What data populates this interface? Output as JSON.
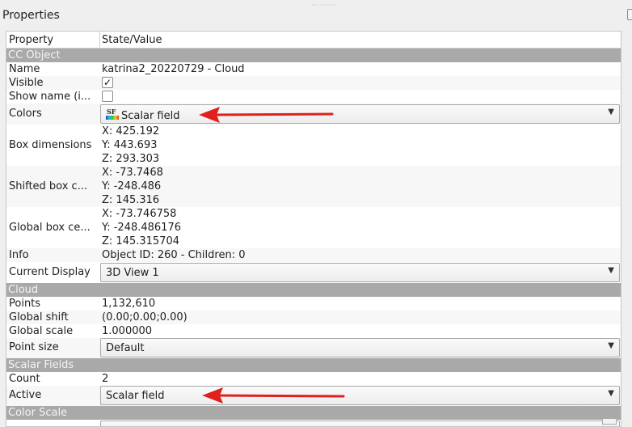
{
  "panel": {
    "title": "Properties"
  },
  "table": {
    "headers": {
      "property": "Property",
      "value": "State/Value"
    },
    "sections": {
      "cc_object": "CC Object",
      "cloud": "Cloud",
      "scalar_fields": "Scalar Fields",
      "color_scale": "Color Scale"
    },
    "rows": {
      "name": {
        "label": "Name",
        "value": "katrina2_20220729 - Cloud"
      },
      "visible": {
        "label": "Visible",
        "checked": true,
        "check_mark": "✓"
      },
      "show_name": {
        "label": "Show name (i...",
        "checked": false
      },
      "colors": {
        "label": "Colors",
        "value": "Scalar field",
        "icon": "scalar-field-icon",
        "icon_text": "SF"
      },
      "box_dimensions": {
        "label": "Box dimensions",
        "x": "X: 425.192",
        "y": "Y: 443.693",
        "z": "Z: 293.303"
      },
      "shifted_box": {
        "label": "Shifted box c...",
        "x": "X: -73.7468",
        "y": "Y: -248.486",
        "z": "Z: 145.316"
      },
      "global_box": {
        "label": "Global box ce...",
        "x": "X: -73.746758",
        "y": "Y: -248.486176",
        "z": "Z: 145.315704"
      },
      "info": {
        "label": "Info",
        "value": "Object ID: 260 - Children: 0"
      },
      "current_display": {
        "label": "Current Display",
        "value": "3D View 1"
      },
      "points": {
        "label": "Points",
        "value": "1,132,610"
      },
      "global_shift": {
        "label": "Global shift",
        "value": "(0.00;0.00;0.00)"
      },
      "global_scale": {
        "label": "Global scale",
        "value": "1.000000"
      },
      "point_size": {
        "label": "Point size",
        "value": "Default"
      },
      "count": {
        "label": "Count",
        "value": "2"
      },
      "active": {
        "label": "Active",
        "value": "Scalar field"
      }
    }
  },
  "annotations": {
    "arrow_color": "#e0201c"
  },
  "colors": {
    "section_bg": "#a9a9a9",
    "panel_bg": "#efefef"
  }
}
